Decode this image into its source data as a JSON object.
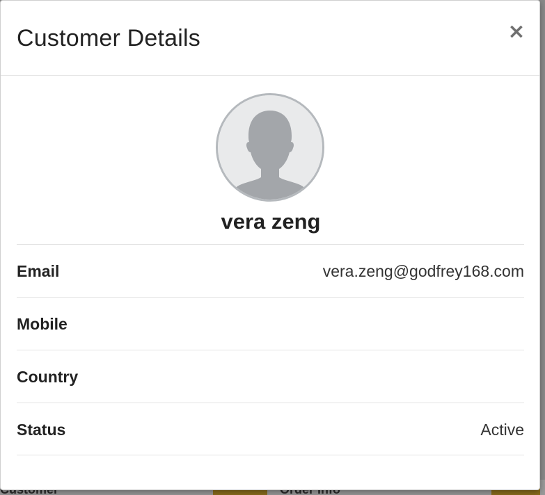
{
  "modal": {
    "title": "Customer Details",
    "close_label": "×"
  },
  "customer": {
    "name": "vera zeng"
  },
  "details": [
    {
      "label": "Email",
      "value": "vera.zeng@godfrey168.com"
    },
    {
      "label": "Mobile",
      "value": ""
    },
    {
      "label": "Country",
      "value": ""
    },
    {
      "label": "Status",
      "value": "Active"
    }
  ],
  "background": {
    "peek_left_text": "Customer",
    "peek_right_text": "Order Info"
  },
  "colors": {
    "title_text": "#222222",
    "avatar_border": "#b5b9bd",
    "avatar_silhouette": "#a3a6aa",
    "divider": "#e2e2e2"
  },
  "icons": {
    "close": "close-icon",
    "avatar": "user-silhouette-icon"
  }
}
